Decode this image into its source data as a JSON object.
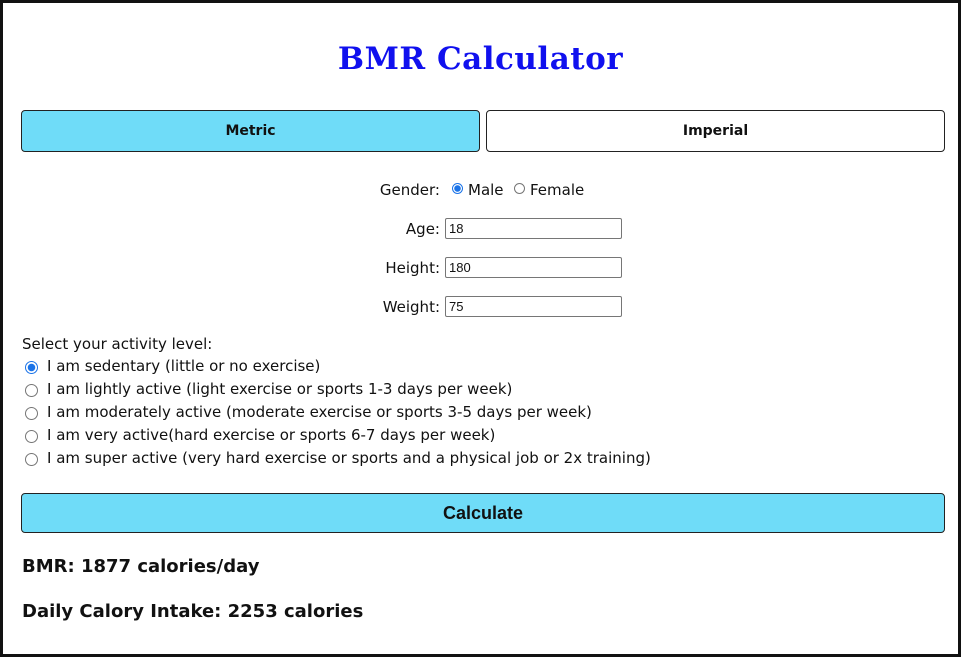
{
  "header": {
    "title": "BMR Calculator"
  },
  "unit_tabs": [
    {
      "label": "Metric",
      "active": true
    },
    {
      "label": "Imperial",
      "active": false
    }
  ],
  "form": {
    "gender": {
      "label": "Gender:",
      "options": [
        "Male",
        "Female"
      ],
      "selected": "Male"
    },
    "age": {
      "label": "Age:",
      "value": "18"
    },
    "height": {
      "label": "Height:",
      "value": "180"
    },
    "weight": {
      "label": "Weight:",
      "value": "75"
    }
  },
  "activity": {
    "title": "Select your activity level:",
    "options": [
      "I am sedentary (little or no exercise)",
      "I am lightly active (light exercise or sports 1-3 days per week)",
      "I am moderately active (moderate exercise or sports 3-5 days per week)",
      "I am very active(hard exercise or sports 6-7 days per week)",
      "I am super active (very hard exercise or sports and a physical job or 2x training)"
    ],
    "selected_index": 0
  },
  "actions": {
    "calculate_label": "Calculate"
  },
  "results": {
    "bmr": "BMR: 1877 calories/day",
    "daily_intake": "Daily Calory Intake: 2253 calories"
  },
  "colors": {
    "title": "#1010ee",
    "accent": "#6fdcf8",
    "radio_checked": "#1a73e8"
  }
}
